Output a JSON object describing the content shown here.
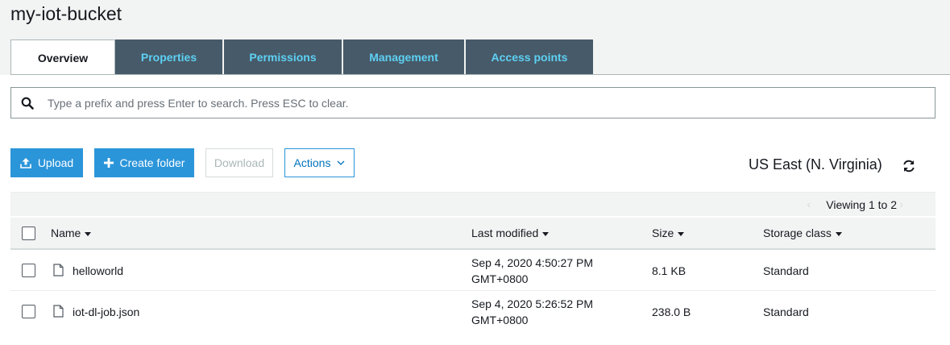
{
  "bucket": {
    "name": "my-iot-bucket"
  },
  "tabs": [
    {
      "label": "Overview",
      "active": true
    },
    {
      "label": "Properties",
      "active": false
    },
    {
      "label": "Permissions",
      "active": false
    },
    {
      "label": "Management",
      "active": false
    },
    {
      "label": "Access points",
      "active": false
    }
  ],
  "search": {
    "placeholder": "Type a prefix and press Enter to search. Press ESC to clear.",
    "value": "",
    "icon": "search-icon"
  },
  "toolbar": {
    "upload_label": "Upload",
    "create_folder_label": "Create folder",
    "download_label": "Download",
    "actions_label": "Actions",
    "region": "US East (N. Virginia)",
    "refresh_icon": "refresh-icon"
  },
  "pager": {
    "viewing": "Viewing 1 to 2"
  },
  "table": {
    "columns": {
      "name": "Name",
      "modified": "Last modified",
      "size": "Size",
      "storage": "Storage class"
    },
    "rows": [
      {
        "name": "helloworld",
        "modified_date": "Sep 4, 2020 4:50:27 PM",
        "modified_tz": "GMT+0800",
        "size": "8.1 KB",
        "storage": "Standard",
        "icon": "file-icon"
      },
      {
        "name": "iot-dl-job.json",
        "modified_date": "Sep 4, 2020 5:26:52 PM",
        "modified_tz": "GMT+0800",
        "size": "238.0 B",
        "storage": "Standard",
        "icon": "file-icon"
      }
    ]
  },
  "colors": {
    "accent": "#2b95da",
    "tab_bg": "#475a69",
    "tab_text": "#5dd0f3",
    "header_bg": "#f2f3f3"
  }
}
